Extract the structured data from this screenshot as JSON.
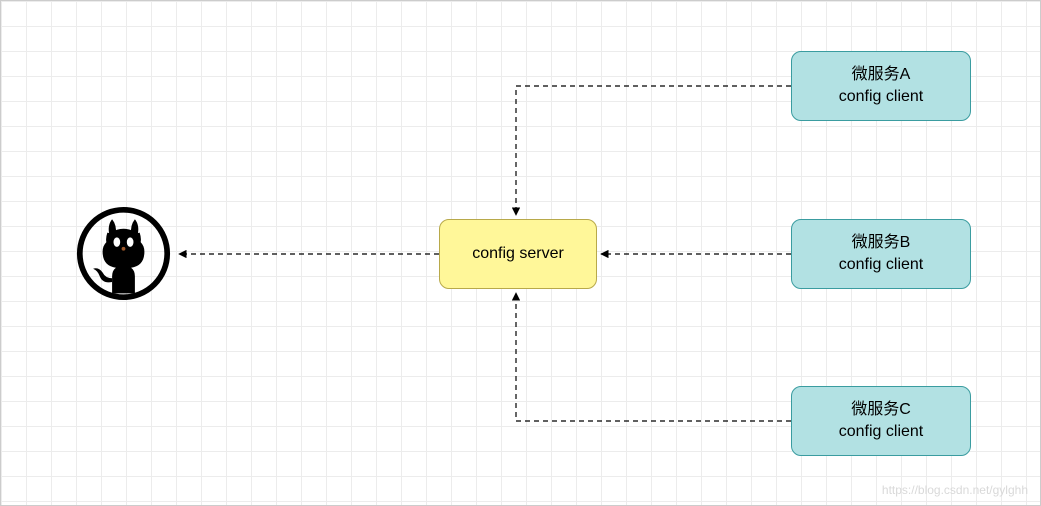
{
  "diagram": {
    "config_server": {
      "label": "config server"
    },
    "clients": {
      "a": {
        "title": "微服务A",
        "subtitle": "config client"
      },
      "b": {
        "title": "微服务B",
        "subtitle": "config client"
      },
      "c": {
        "title": "微服务C",
        "subtitle": "config client"
      }
    }
  },
  "watermark": "https://blog.csdn.net/gylghh"
}
